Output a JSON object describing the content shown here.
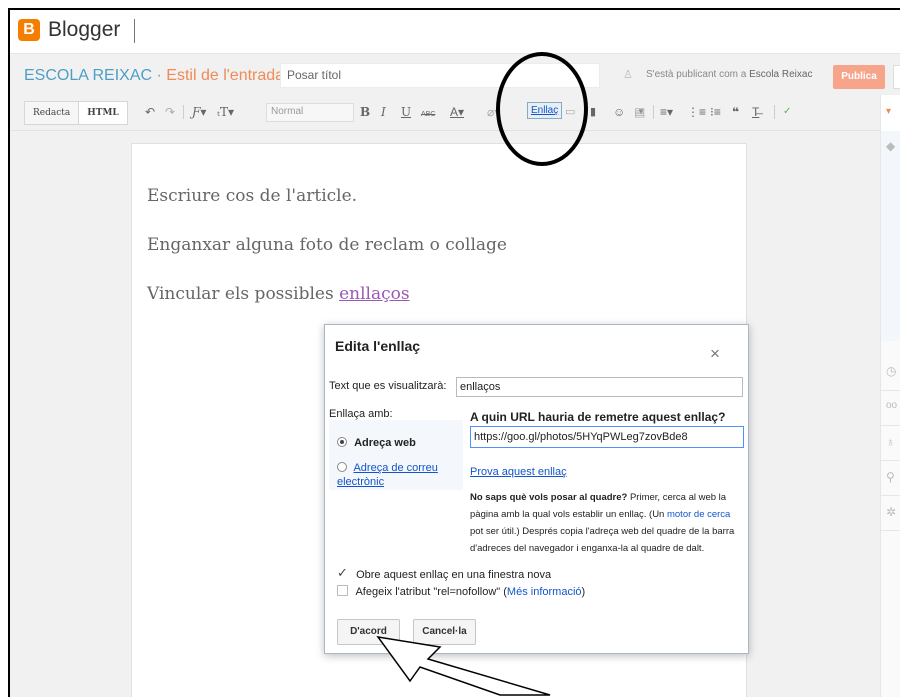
{
  "app": {
    "brand": "Blogger",
    "logo_letter": "B"
  },
  "titlebar": {
    "blog_name": "ESCOLA REIXAC",
    "separator": "·",
    "edit_label": "Estil de l'entrada",
    "title_placeholder": "Posar títol",
    "publishing_as_prefix": "S'està publicant com a",
    "publishing_as_name": "Escola Reixac",
    "publish_label": "Publica"
  },
  "toolbar": {
    "compose_label": "Redacta",
    "html_label": "HTML",
    "font_select_value": "Normal",
    "link_label": "Enllaç"
  },
  "editor": {
    "paragraphs": [
      "Escriure cos de l'article.",
      "Enganxar alguna foto de reclam o collage"
    ],
    "link_paragraph_prefix": "Vincular els possibles ",
    "link_paragraph_link": "enllaços"
  },
  "dialog": {
    "title": "Edita l'enllaç",
    "close_symbol": "×",
    "text_label": "Text que es visualitzarà:",
    "text_value": "enllaços",
    "link_with_label": "Enllaça amb:",
    "option_web": "Adreça web",
    "option_email": "Adreça de correu electrònic",
    "url_heading": "A quin URL hauria de remetre aquest enllaç?",
    "url_value": "https://goo.gl/photos/5HYqPWLeg7zovBde8",
    "test_link": "Prova aquest enllaç",
    "help_bold": "No saps què vols posar al quadre?",
    "help_text_1": " Primer, cerca al web la pàgina amb la qual vols establir un enllaç. (Un ",
    "help_link": "motor de cerca",
    "help_text_2": " pot ser útil.) Després copia l'adreça web del quadre de la barra d'adreces del navegador i enganxa-la al quadre de dalt.",
    "new_window_label": "Obre aquest enllaç en una finestra nova",
    "new_window_checked": true,
    "nofollow_label": "Afegeix l'atribut \"rel=nofollow\" (",
    "nofollow_more": "Més informació",
    "nofollow_close": ")",
    "nofollow_checked": false,
    "ok_label": "D'acord",
    "cancel_label": "Cancel·la"
  },
  "colors": {
    "blogger_orange": "#f57d00",
    "blog_name_blue": "#4d9fc6",
    "edit_label_orange": "#f08a57",
    "publish_button": "#f6a48a",
    "link_blue": "#1155cc"
  }
}
